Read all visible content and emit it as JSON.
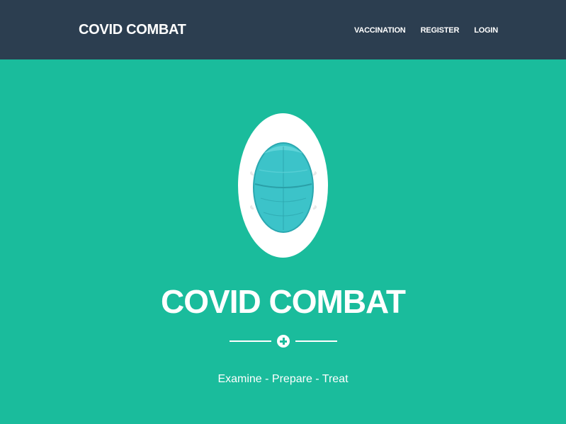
{
  "navbar": {
    "brand": "COVID COMBAT",
    "links": [
      {
        "label": "VACCINATION"
      },
      {
        "label": "REGISTER"
      },
      {
        "label": "LOGIN"
      }
    ]
  },
  "masthead": {
    "image_icon": "n95-mask-icon",
    "title": "COVID COMBAT",
    "divider_icon": "plus-circle-icon",
    "subtitle": "Examine - Prepare - Treat"
  },
  "colors": {
    "navbar_bg": "#2c3e50",
    "masthead_bg": "#1abc9c",
    "mask": "#3cc3c9",
    "text": "#ffffff"
  }
}
